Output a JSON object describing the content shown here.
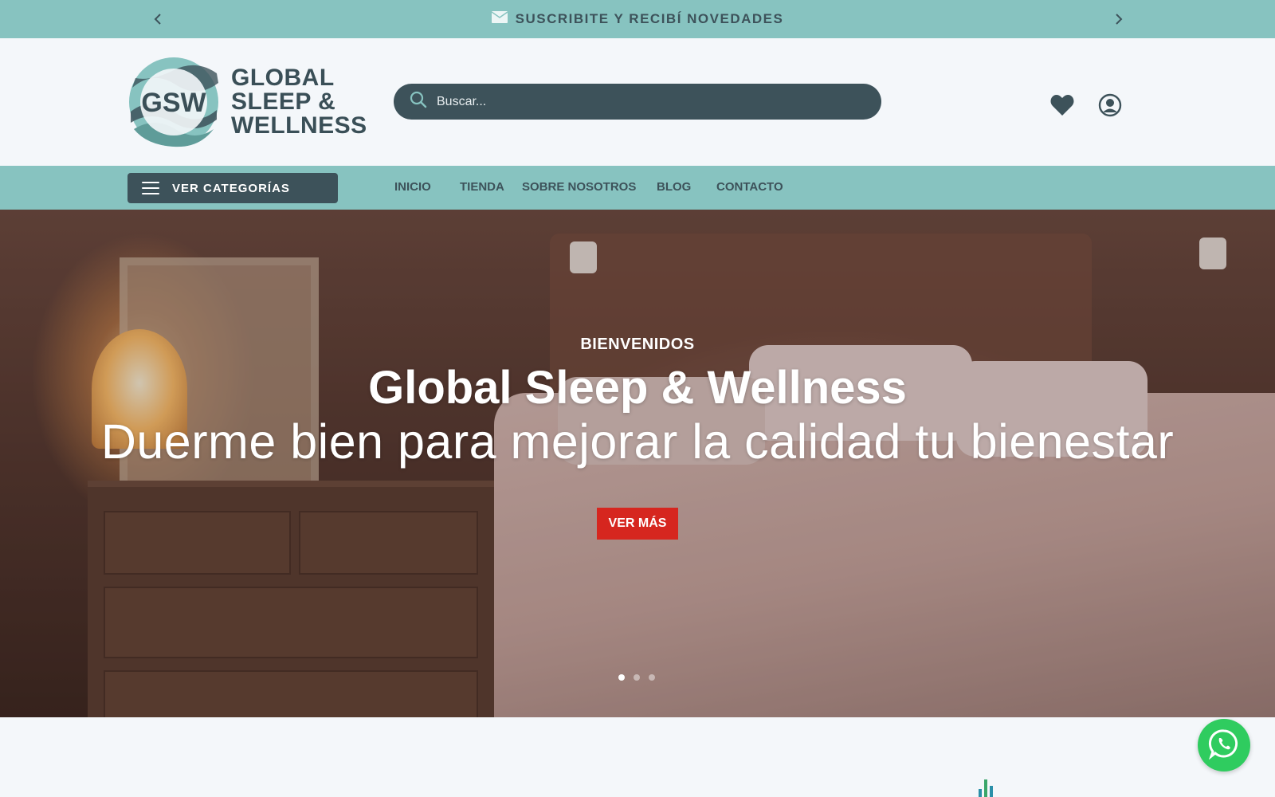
{
  "announcement": {
    "text": "SUSCRIBITE Y RECIBÍ NOVEDADES",
    "icon": "envelope-icon",
    "prev_icon": "chevron-left-icon",
    "next_icon": "chevron-right-icon"
  },
  "header": {
    "logo": {
      "monogram": "GSW",
      "line1": "GLOBAL",
      "line2": "SLEEP &",
      "line3": "WELLNESS"
    },
    "search": {
      "placeholder": "Buscar...",
      "icon": "search-icon"
    },
    "icons": [
      "heart-icon",
      "user-icon"
    ]
  },
  "nav": {
    "categories_label": "VER CATEGORÍAS",
    "links": [
      "INICIO",
      "TIENDA",
      "SOBRE NOSOTROS",
      "BLOG",
      "CONTACTO"
    ]
  },
  "hero": {
    "kicker": "BIENVENIDOS",
    "title": "Global Sleep & Wellness",
    "subtitle": "Duerme bien para mejorar la calidad tu bienestar",
    "cta_label": "VER MÁS",
    "slides_total": 3,
    "active_slide": 1
  },
  "floating": {
    "whatsapp_icon": "whatsapp-icon"
  },
  "colors": {
    "teal": "#87c3c0",
    "dark_slate": "#3d525a",
    "cta_red": "#d6261f",
    "whatsapp_green": "#2fcc5f",
    "background": "#f4f7fa"
  }
}
